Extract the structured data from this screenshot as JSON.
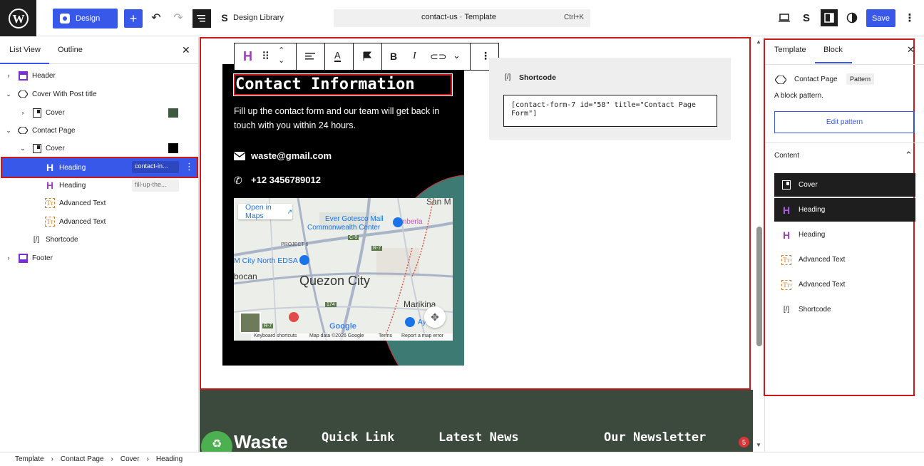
{
  "topbar": {
    "design_label": "Design",
    "design_library_label": "Design Library",
    "doc_title": "contact-us · Template",
    "shortcut": "Ctrl+K",
    "save_label": "Save"
  },
  "left_panel": {
    "tabs": [
      "List View",
      "Outline"
    ],
    "tree": [
      {
        "label": "Header"
      },
      {
        "label": "Cover With Post title"
      },
      {
        "label": "Cover"
      },
      {
        "label": "Contact Page"
      },
      {
        "label": "Cover"
      },
      {
        "label": "Heading",
        "tag": "contact-in..."
      },
      {
        "label": "Heading",
        "tag": "fill-up-the..."
      },
      {
        "label": "Advanced Text"
      },
      {
        "label": "Advanced Text"
      },
      {
        "label": "Shortcode"
      },
      {
        "label": "Footer"
      }
    ]
  },
  "canvas": {
    "heading": "Contact Information",
    "paragraph": "Fill up the contact form and our team will get back in touch with you within 24 hours.",
    "email": "waste@gmail.com",
    "phone": "+12 3456789012",
    "map": {
      "open_in_maps": "Open in Maps",
      "labels": [
        "San M",
        "Ever Gotesco Mall",
        "Commonwealth Center",
        "Timberla",
        "PROJECT 6",
        "C-5",
        "R-7",
        "M City North EDSA",
        "bocan",
        "Quezon City",
        "174",
        "Marikina",
        "Ay",
        "R-7"
      ],
      "footer": [
        "Keyboard shortcuts",
        "Map data ©2026 Google",
        "Terms",
        "Report a map error"
      ],
      "google": "Google"
    },
    "shortcode_title": "Shortcode",
    "shortcode_value": "[contact-form-7 id=\"58\" title=\"Contact Page Form\"]",
    "footer": {
      "logo_text": "Waste",
      "col1": "Quick Link",
      "col2": "Latest News",
      "col3": "Our Newsletter",
      "badge": "5"
    }
  },
  "right_panel": {
    "tabs": [
      "Template",
      "Block"
    ],
    "block_name": "Contact Page",
    "block_badge": "Pattern",
    "description": "A block pattern.",
    "edit_label": "Edit pattern",
    "content_title": "Content",
    "items": [
      "Cover",
      "Heading",
      "Heading",
      "Advanced Text",
      "Advanced Text",
      "Shortcode"
    ]
  },
  "breadcrumb": [
    "Template",
    "Contact Page",
    "Cover",
    "Heading"
  ],
  "colors": {
    "accent": "#3858e9",
    "highlight_red": "#cc1818",
    "footer_bg": "#3b4a3c",
    "heading_purple": "#9b3fb3",
    "advanced_orange": "#e07b25"
  }
}
